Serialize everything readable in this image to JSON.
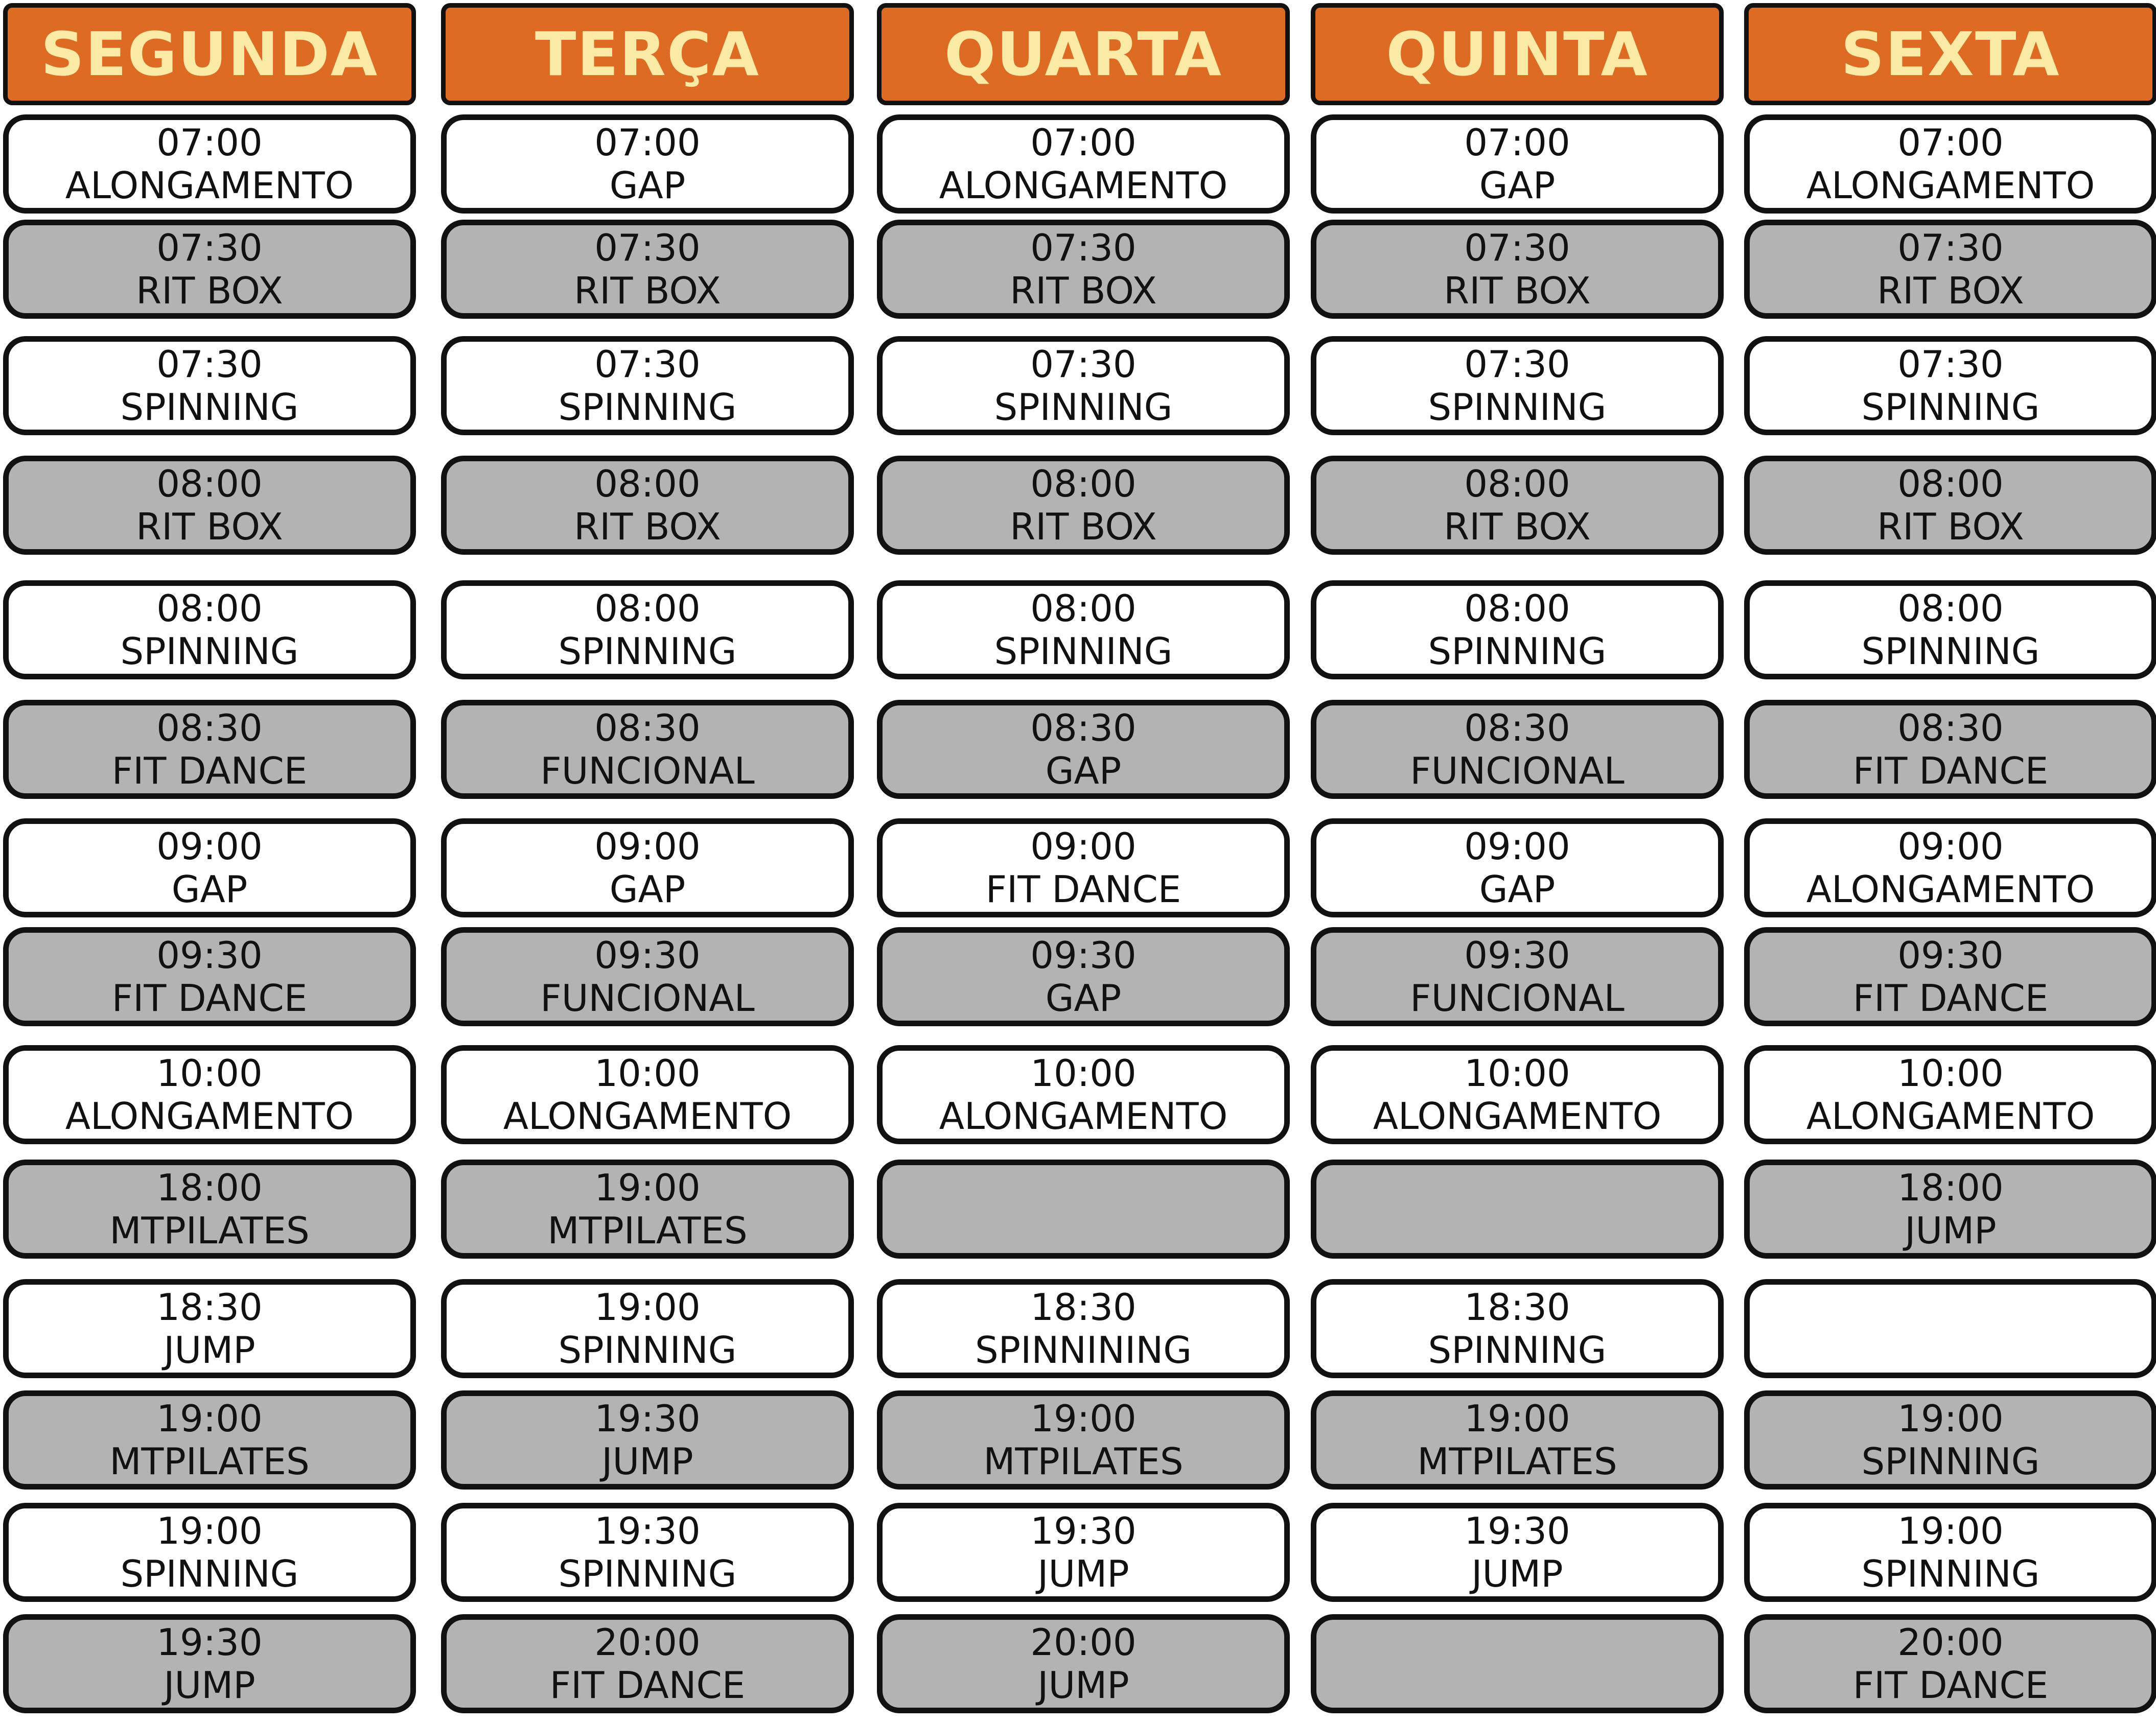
{
  "colors": {
    "header_bg": "#dd6b23",
    "header_text": "#fbe9a6",
    "slot_white": "#ffffff",
    "slot_gray": "#b3b3b3",
    "border": "#111111"
  },
  "days": [
    {
      "name": "SEGUNDA",
      "slots": [
        {
          "time": "07:00",
          "activity": "ALONGAMENTO"
        },
        {
          "time": "07:30",
          "activity": "RIT BOX"
        },
        {
          "time": "07:30",
          "activity": "SPINNING"
        },
        {
          "time": "08:00",
          "activity": "RIT BOX"
        },
        {
          "time": "08:00",
          "activity": "SPINNING"
        },
        {
          "time": "08:30",
          "activity": "FIT DANCE"
        },
        {
          "time": "09:00",
          "activity": "GAP"
        },
        {
          "time": "09:30",
          "activity": "FIT DANCE"
        },
        {
          "time": "10:00",
          "activity": "ALONGAMENTO"
        },
        {
          "time": "18:00",
          "activity": "MTPILATES"
        },
        {
          "time": "18:30",
          "activity": "JUMP"
        },
        {
          "time": "19:00",
          "activity": "MTPILATES"
        },
        {
          "time": "19:00",
          "activity": "SPINNING"
        },
        {
          "time": "19:30",
          "activity": "JUMP"
        }
      ]
    },
    {
      "name": "TERÇA",
      "slots": [
        {
          "time": "07:00",
          "activity": "GAP"
        },
        {
          "time": "07:30",
          "activity": "RIT BOX"
        },
        {
          "time": "07:30",
          "activity": "SPINNING"
        },
        {
          "time": "08:00",
          "activity": "RIT BOX"
        },
        {
          "time": "08:00",
          "activity": "SPINNING"
        },
        {
          "time": "08:30",
          "activity": "FUNCIONAL"
        },
        {
          "time": "09:00",
          "activity": "GAP"
        },
        {
          "time": "09:30",
          "activity": "FUNCIONAL"
        },
        {
          "time": "10:00",
          "activity": "ALONGAMENTO"
        },
        {
          "time": "19:00",
          "activity": "MTPILATES"
        },
        {
          "time": "19:00",
          "activity": "SPINNING"
        },
        {
          "time": "19:30",
          "activity": "JUMP"
        },
        {
          "time": "19:30",
          "activity": "SPINNING"
        },
        {
          "time": "20:00",
          "activity": "FIT DANCE"
        }
      ]
    },
    {
      "name": "QUARTA",
      "slots": [
        {
          "time": "07:00",
          "activity": "ALONGAMENTO"
        },
        {
          "time": "07:30",
          "activity": "RIT BOX"
        },
        {
          "time": "07:30",
          "activity": "SPINNING"
        },
        {
          "time": "08:00",
          "activity": "RIT BOX"
        },
        {
          "time": "08:00",
          "activity": "SPINNING"
        },
        {
          "time": "08:30",
          "activity": "GAP"
        },
        {
          "time": "09:00",
          "activity": "FIT DANCE"
        },
        {
          "time": "09:30",
          "activity": "GAP"
        },
        {
          "time": "10:00",
          "activity": "ALONGAMENTO"
        },
        {
          "time": "",
          "activity": ""
        },
        {
          "time": "18:30",
          "activity": "SPINNINING"
        },
        {
          "time": "19:00",
          "activity": "MTPILATES"
        },
        {
          "time": "19:30",
          "activity": "JUMP"
        },
        {
          "time": "20:00",
          "activity": "JUMP"
        }
      ]
    },
    {
      "name": "QUINTA",
      "slots": [
        {
          "time": "07:00",
          "activity": "GAP"
        },
        {
          "time": "07:30",
          "activity": "RIT BOX"
        },
        {
          "time": "07:30",
          "activity": "SPINNING"
        },
        {
          "time": "08:00",
          "activity": "RIT BOX"
        },
        {
          "time": "08:00",
          "activity": "SPINNING"
        },
        {
          "time": "08:30",
          "activity": "FUNCIONAL"
        },
        {
          "time": "09:00",
          "activity": "GAP"
        },
        {
          "time": "09:30",
          "activity": "FUNCIONAL"
        },
        {
          "time": "10:00",
          "activity": "ALONGAMENTO"
        },
        {
          "time": "",
          "activity": ""
        },
        {
          "time": "18:30",
          "activity": "SPINNING"
        },
        {
          "time": "19:00",
          "activity": "MTPILATES"
        },
        {
          "time": "19:30",
          "activity": "JUMP"
        },
        {
          "time": "",
          "activity": ""
        }
      ]
    },
    {
      "name": "SEXTA",
      "slots": [
        {
          "time": "07:00",
          "activity": "ALONGAMENTO"
        },
        {
          "time": "07:30",
          "activity": "RIT BOX"
        },
        {
          "time": "07:30",
          "activity": "SPINNING"
        },
        {
          "time": "08:00",
          "activity": "RIT BOX"
        },
        {
          "time": "08:00",
          "activity": "SPINNING"
        },
        {
          "time": "08:30",
          "activity": "FIT DANCE"
        },
        {
          "time": "09:00",
          "activity": "ALONGAMENTO"
        },
        {
          "time": "09:30",
          "activity": "FIT DANCE"
        },
        {
          "time": "10:00",
          "activity": "ALONGAMENTO"
        },
        {
          "time": "18:00",
          "activity": "JUMP"
        },
        {
          "time": "",
          "activity": ""
        },
        {
          "time": "19:00",
          "activity": "SPINNING"
        },
        {
          "time": "19:00",
          "activity": "SPINNING"
        },
        {
          "time": "20:00",
          "activity": "FIT DANCE"
        }
      ]
    }
  ]
}
